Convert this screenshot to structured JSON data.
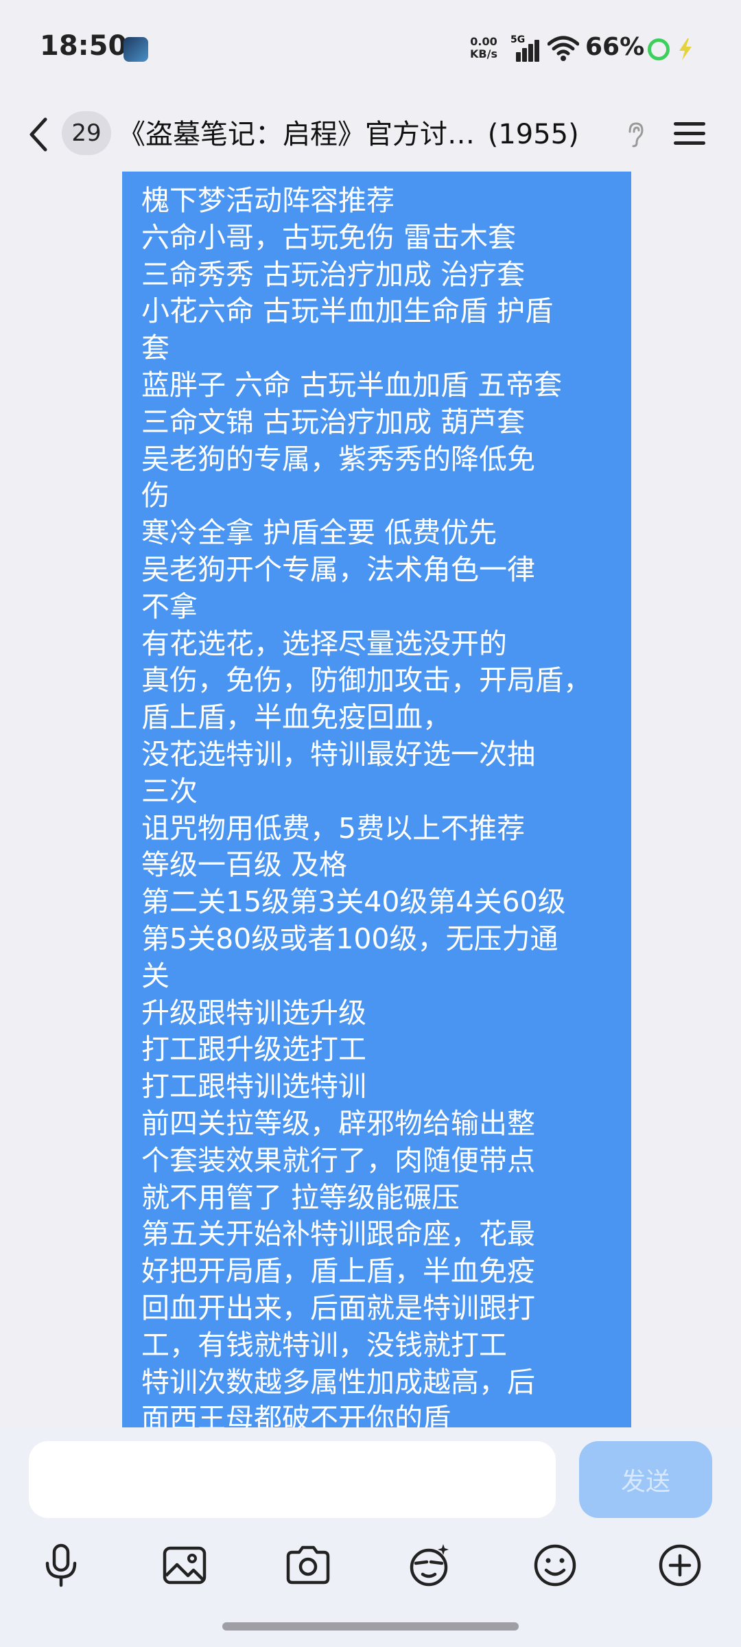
{
  "status_bar": {
    "time": "18:50",
    "net_speed_value": "0.00",
    "net_speed_unit": "KB/s",
    "network": "5G",
    "battery": "66%"
  },
  "header": {
    "unread_count": "29",
    "title": "《盗墓笔记：启程》官方讨…",
    "member_count": "(1955)"
  },
  "message": {
    "lines": [
      "槐下梦活动阵容推荐",
      "六命小哥，古玩免伤  雷击木套",
      "三命秀秀 古玩治疗加成 治疗套",
      "小花六命 古玩半血加生命盾 护盾",
      "套",
      "蓝胖子 六命 古玩半血加盾 五帝套",
      "三命文锦 古玩治疗加成 葫芦套",
      "吴老狗的专属，紫秀秀的降低免",
      "伤",
      "寒冷全拿 护盾全要 低费优先",
      "吴老狗开个专属，法术角色一律",
      "不拿",
      "有花选花，选择尽量选没开的",
      "真伤，免伤，防御加攻击，开局盾，",
      "盾上盾，半血免疫回血，",
      "没花选特训，特训最好选一次抽",
      "三次",
      "诅咒物用低费，5费以上不推荐",
      "等级一百级 及格",
      "第二关15级第3关40级第4关60级",
      "第5关80级或者100级，无压力通",
      "关",
      "升级跟特训选升级",
      "打工跟升级选打工",
      "打工跟特训选特训",
      "前四关拉等级，辟邪物给输出整",
      "个套装效果就行了，肉随便带点",
      "就不用管了  拉等级能碾压",
      "第五关开始补特训跟命座，花最",
      "好把开局盾，盾上盾，半血免疫",
      "回血开出来，后面就是特训跟打",
      "工，有钱就特训，没钱就打工",
      "特训次数越多属性加成越高，后",
      "面西王母都破不开你的盾"
    ]
  },
  "input": {
    "value": "",
    "send_label": "发送"
  },
  "toolbar": {
    "icons": [
      "microphone-icon",
      "image-icon",
      "camera-icon",
      "sticker-icon",
      "emoji-icon",
      "plus-icon"
    ]
  },
  "colors": {
    "bubble": "#4a94f2",
    "send_disabled": "#9cc6f8",
    "background": "#f0f0f4"
  }
}
